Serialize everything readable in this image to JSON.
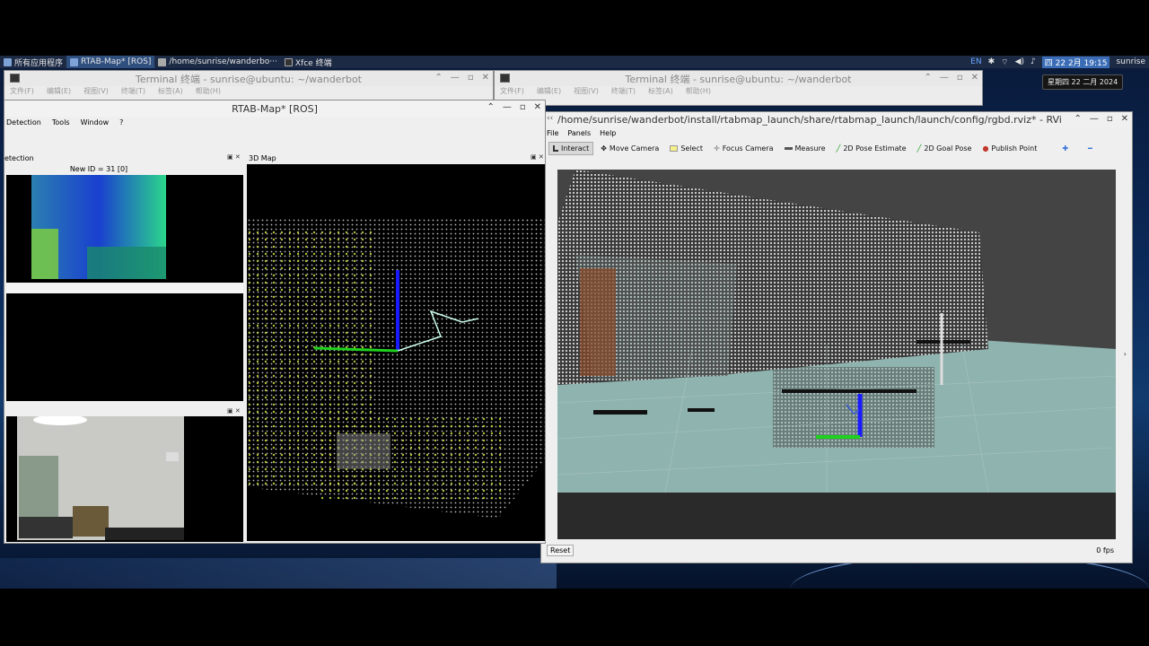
{
  "taskbar": {
    "apps_menu": "所有应用程序",
    "tasks": [
      {
        "label": "RTAB-Map* [ROS]"
      },
      {
        "label": "/home/sunrise/wanderbo···"
      },
      {
        "label": "Xfce 终端"
      }
    ],
    "tray": {
      "lang": "EN",
      "clock": "四 22 2月 19:15",
      "user": "sunrise"
    },
    "clock_tooltip": "星期四 22 二月 2024"
  },
  "terminal_left": {
    "title": "Terminal 终端 - sunrise@ubuntu: ~/wanderbot",
    "menu": [
      "文件(F)",
      "编辑(E)",
      "视图(V)",
      "终端(T)",
      "标签(A)",
      "帮助(H)"
    ]
  },
  "terminal_right": {
    "title": "Terminal 终端 - sunrise@ubuntu: ~/wanderbot",
    "menu": [
      "文件(F)",
      "编辑(E)",
      "视图(V)",
      "终端(T)",
      "标签(A)",
      "帮助(H)"
    ]
  },
  "rtabmap": {
    "title": "RTAB-Map* [ROS]",
    "menu": [
      "Detection",
      "Tools",
      "Window",
      "?"
    ],
    "loop_dock_title": "etection",
    "new_id": "New ID = 31 [0]",
    "map_dock_title": "3D Map"
  },
  "rviz": {
    "title": "/home/sunrise/wanderbot/install/rtabmap_launch/share/rtabmap_launch/launch/config/rgbd.rviz* - RVi",
    "menu": [
      "File",
      "Panels",
      "Help"
    ],
    "tools": [
      {
        "label": "Interact",
        "icon": "cursor-icon",
        "active": true
      },
      {
        "label": "Move Camera",
        "icon": "move-camera-icon",
        "active": false
      },
      {
        "label": "Select",
        "icon": "select-icon",
        "active": false
      },
      {
        "label": "Focus Camera",
        "icon": "focus-camera-icon",
        "active": false
      },
      {
        "label": "Measure",
        "icon": "measure-icon",
        "active": false
      },
      {
        "label": "2D Pose Estimate",
        "icon": "pose-estimate-icon",
        "active": false
      },
      {
        "label": "2D Goal Pose",
        "icon": "goal-pose-icon",
        "active": false
      },
      {
        "label": "Publish Point",
        "icon": "publish-point-icon",
        "active": false
      }
    ],
    "reset_label": "Reset",
    "fps": "0 fps"
  },
  "colors": {
    "axis_x": "#1fd11f",
    "axis_z": "#1a1aff",
    "panel_bg": "#1c2a44",
    "grid_floor": "#8fb3ae"
  }
}
